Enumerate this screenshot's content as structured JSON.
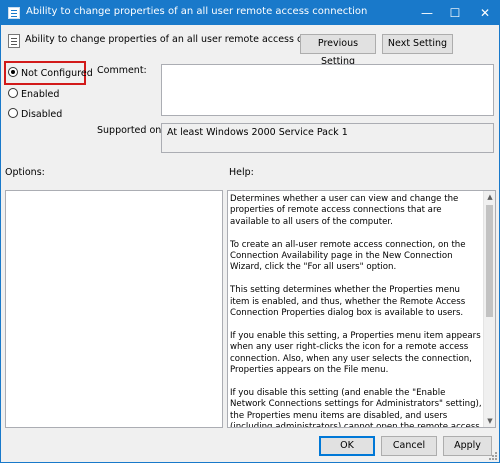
{
  "window": {
    "title": "Ability to change properties of an all user remote access connection",
    "controls": {
      "minimize": "—",
      "maximize": "☐",
      "close": "✕"
    }
  },
  "header": {
    "title": "Ability to change properties of an all user remote access connection",
    "previous_setting": "Previous Setting",
    "next_setting": "Next Setting"
  },
  "state": {
    "options": [
      {
        "label": "Not Configured",
        "selected": true
      },
      {
        "label": "Enabled",
        "selected": false
      },
      {
        "label": "Disabled",
        "selected": false
      }
    ]
  },
  "comment": {
    "label": "Comment:",
    "value": ""
  },
  "supported_on": {
    "label": "Supported on:",
    "value": "At least Windows 2000 Service Pack 1"
  },
  "options_panel": {
    "label": "Options:"
  },
  "help_panel": {
    "label": "Help:",
    "paragraphs": [
      "Determines whether a user can view and change the properties of remote access connections that are available to all users of the computer.",
      "To create an all-user remote access connection, on the Connection Availability page in the New Connection Wizard, click the \"For all users\" option.",
      "This setting determines whether the Properties menu item is enabled, and thus, whether the Remote Access Connection Properties dialog box is available to users.",
      "If you enable this setting, a Properties menu item appears when any user right-clicks the icon for a remote access connection. Also, when any user selects the connection, Properties appears on the File menu.",
      "If you disable this setting (and enable the \"Enable Network Connections settings for Administrators\" setting), the Properties menu items are disabled, and users (including administrators) cannot open the remote access connection properties dialog"
    ]
  },
  "footer": {
    "ok": "OK",
    "cancel": "Cancel",
    "apply": "Apply"
  },
  "colors": {
    "titlebar": "#1979ca",
    "highlight": "#d21a1a",
    "focus": "#0078d7"
  }
}
